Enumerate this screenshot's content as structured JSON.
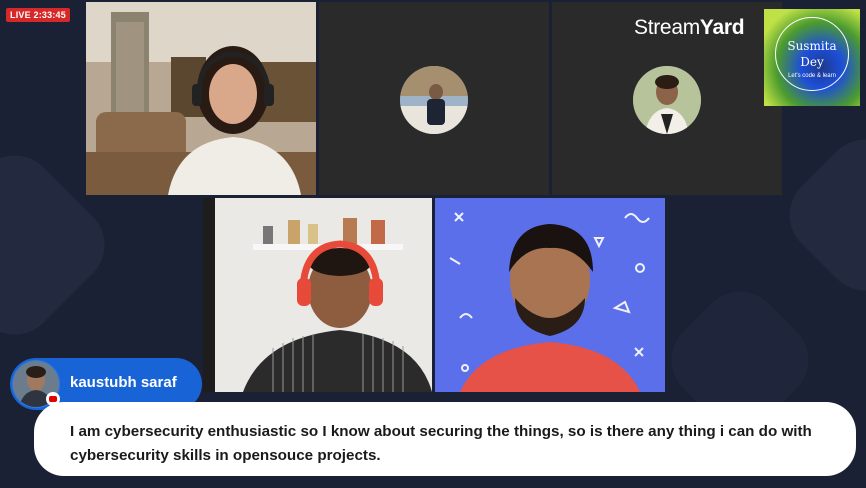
{
  "live": {
    "label": "LIVE 2:33:45"
  },
  "brand": {
    "logo_light": "Stream",
    "logo_bold": "Yard"
  },
  "host_badge": {
    "name_line1": "Susmita",
    "name_line2": "Dey",
    "tagline": "Let's code & learn"
  },
  "participants": [
    {
      "id": "guest-woman-headphones",
      "view": "camera"
    },
    {
      "id": "guest-avatar-1",
      "view": "avatar"
    },
    {
      "id": "guest-avatar-2",
      "view": "avatar"
    },
    {
      "id": "guest-man-red-headphones",
      "view": "camera"
    },
    {
      "id": "guest-man-blue-bg",
      "view": "camera"
    }
  ],
  "comment": {
    "author": "kaustubh saraf",
    "platform_icon": "youtube-icon",
    "text": "I am cybersecurity enthusiastic so I know about securing the things, so is there any thing i can do with cybersecurity skills in opensouce projects."
  },
  "colors": {
    "background": "#1b2135",
    "live_badge": "#d62828",
    "name_pill": "#1864d6",
    "comment_bg": "#ffffff"
  }
}
